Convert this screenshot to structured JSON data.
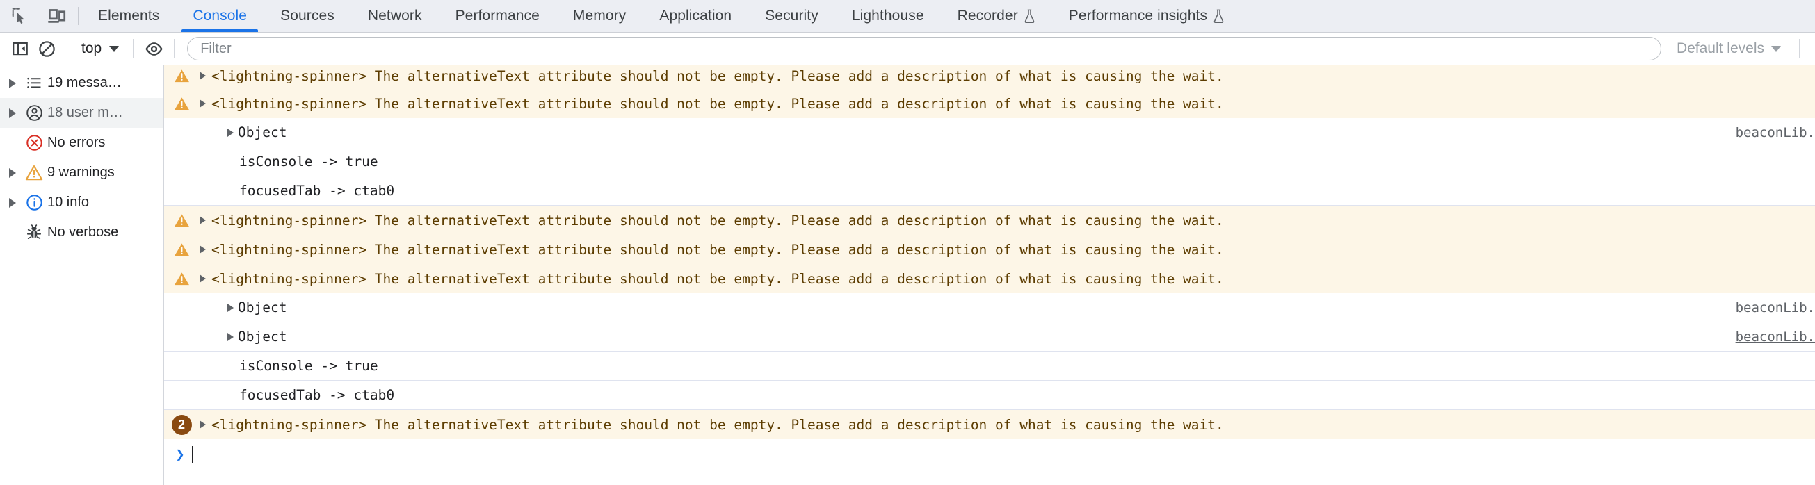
{
  "tabbar": {
    "icons": [
      {
        "name": "inspect-element-icon",
        "label": "Inspect element"
      },
      {
        "name": "device-toolbar-icon",
        "label": "Toggle device toolbar"
      }
    ],
    "tabs": [
      {
        "label": "Elements",
        "active": false,
        "experimental": false
      },
      {
        "label": "Console",
        "active": true,
        "experimental": false
      },
      {
        "label": "Sources",
        "active": false,
        "experimental": false
      },
      {
        "label": "Network",
        "active": false,
        "experimental": false
      },
      {
        "label": "Performance",
        "active": false,
        "experimental": false
      },
      {
        "label": "Memory",
        "active": false,
        "experimental": false
      },
      {
        "label": "Application",
        "active": false,
        "experimental": false
      },
      {
        "label": "Security",
        "active": false,
        "experimental": false
      },
      {
        "label": "Lighthouse",
        "active": false,
        "experimental": false
      },
      {
        "label": "Recorder",
        "active": false,
        "experimental": true
      },
      {
        "label": "Performance insights",
        "active": false,
        "experimental": true
      }
    ],
    "active_tab": "Console",
    "accent_color": "#1a73e8",
    "background_color": "#eceef3"
  },
  "toolbar": {
    "sidebar_toggle": {
      "name": "show-console-sidebar-icon"
    },
    "clear_console": {
      "name": "clear-console-icon"
    },
    "context_selector": {
      "value": "top"
    },
    "eye_toggle": {
      "name": "create-live-expression-icon"
    },
    "filter": {
      "value": "",
      "placeholder": "Filter"
    },
    "levels": {
      "value": "Default levels"
    }
  },
  "sidebar": {
    "items": [
      {
        "label": "19 messa…",
        "icon": "list-icon",
        "expandable": true,
        "selected": false
      },
      {
        "label": "18 user m…",
        "icon": "user-message-icon",
        "expandable": true,
        "selected": true
      },
      {
        "label": "No errors",
        "icon": "error-icon",
        "expandable": false,
        "selected": false
      },
      {
        "label": "9 warnings",
        "icon": "warning-icon",
        "expandable": true,
        "selected": false
      },
      {
        "label": "10 info",
        "icon": "info-icon",
        "expandable": true,
        "selected": false
      },
      {
        "label": "No verbose",
        "icon": "bug-icon",
        "expandable": false,
        "selected": false
      }
    ]
  },
  "console": {
    "warning_message": "<lightning-spinner> The alternativeText attribute should not be empty. Please add a description of what is causing the wait.",
    "object_label": "Object",
    "source_link": "beaconLib.",
    "kv_isconsole": "isConsole -> true",
    "kv_focusedtab": "focusedTab -> ctab0",
    "badge_count": "2",
    "prompt_chevron": "❯",
    "rows": [
      {
        "kind": "warning",
        "text_ref": "warning_message",
        "badge": null,
        "source": null
      },
      {
        "kind": "warning",
        "text_ref": "warning_message",
        "badge": null,
        "source": null
      },
      {
        "kind": "object",
        "text_ref": "object_label",
        "badge": null,
        "source": "beaconLib."
      },
      {
        "kind": "kv",
        "text_ref": "kv_isconsole",
        "badge": null,
        "source": null
      },
      {
        "kind": "kv",
        "text_ref": "kv_focusedtab",
        "badge": null,
        "source": null
      },
      {
        "kind": "warning",
        "text_ref": "warning_message",
        "badge": null,
        "source": null
      },
      {
        "kind": "warning",
        "text_ref": "warning_message",
        "badge": null,
        "source": null
      },
      {
        "kind": "warning",
        "text_ref": "warning_message",
        "badge": null,
        "source": null
      },
      {
        "kind": "object",
        "text_ref": "object_label",
        "badge": null,
        "source": "beaconLib."
      },
      {
        "kind": "object",
        "text_ref": "object_label",
        "badge": null,
        "source": "beaconLib."
      },
      {
        "kind": "kv",
        "text_ref": "kv_isconsole",
        "badge": null,
        "source": null
      },
      {
        "kind": "kv",
        "text_ref": "kv_focusedtab",
        "badge": null,
        "source": null
      },
      {
        "kind": "warning",
        "text_ref": "warning_message",
        "badge": "2",
        "source": null
      }
    ],
    "colors": {
      "warning_background": "#fdf6e7",
      "warning_text": "#5c3c00",
      "warning_icon": "#e8a33d",
      "badge_background": "#8a4a10",
      "prompt_chevron": "#1a73e8",
      "row_separator": "#dfe3ef"
    }
  }
}
